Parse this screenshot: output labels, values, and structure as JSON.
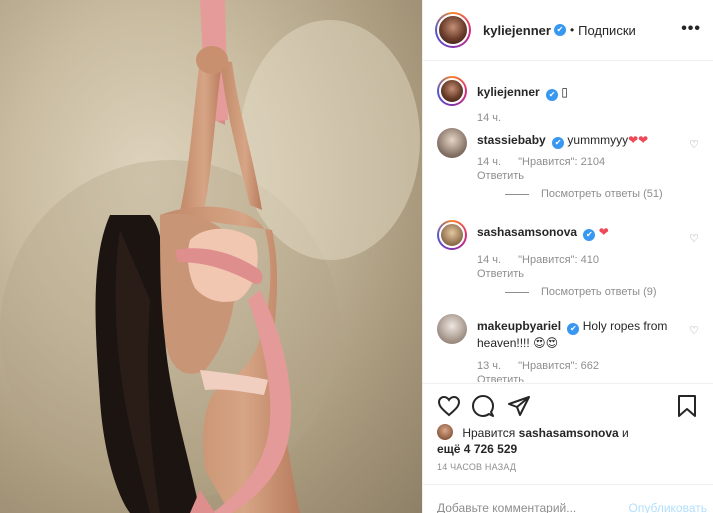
{
  "header": {
    "username": "kyliejenner",
    "separator": "•",
    "follow_label": "Подписки",
    "more_label": "•••",
    "verified_mark": "✔"
  },
  "caption": {
    "username": "kyliejenner",
    "text": "▯",
    "time": "14 ч."
  },
  "comments": [
    {
      "username": "stassiebaby",
      "text": "yummmyyy",
      "emoji": "❤❤",
      "time": "14 ч.",
      "likes": "\"Нравится\": 2104",
      "reply": "Ответить",
      "view_replies": "Посмотреть ответы (51)"
    },
    {
      "username": "sashasamsonova",
      "text": "",
      "emoji": "❤",
      "time": "14 ч.",
      "likes": "\"Нравится\": 410",
      "reply": "Ответить",
      "view_replies": "Посмотреть ответы (9)"
    },
    {
      "username": "makeupbyariel",
      "text": "Holy ropes from heaven!!!!",
      "emoji": "😍😍",
      "time": "13 ч.",
      "likes": "\"Нравится\": 662",
      "reply": "Ответить"
    }
  ],
  "likes": {
    "prefix": "Нравится",
    "user": "sashasamsonova",
    "connector": "и",
    "count_text": "ещё 4 726 529"
  },
  "posted": "14 ЧАСОВ НАЗАД",
  "add_comment": {
    "placeholder": "Добавьте комментарий...",
    "publish": "Опубликовать"
  },
  "icons": [
    "heart-icon",
    "comment-icon",
    "share-icon",
    "bookmark-icon",
    "more-icon",
    "verified-icon"
  ],
  "colors": {
    "verified": "#3897f0",
    "like_red": "#ed4956",
    "muted": "#8e8e8e",
    "publish_disabled": "#b2dffc"
  }
}
